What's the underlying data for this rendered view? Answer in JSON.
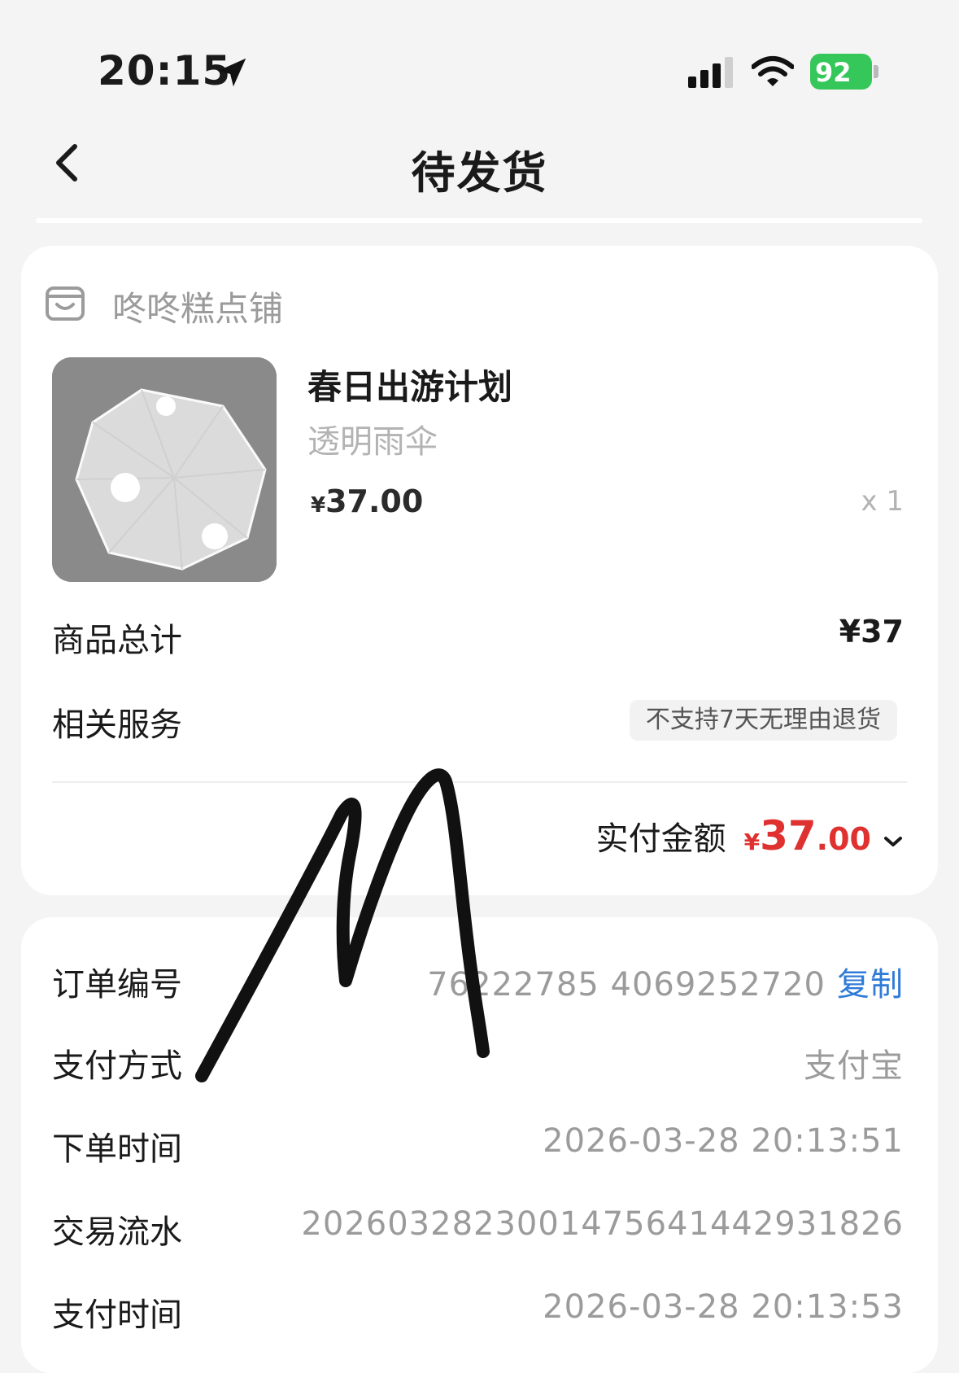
{
  "status_bar": {
    "time": "20:15",
    "battery": "92",
    "battery_color": "#35c759",
    "icons": [
      "location-arrow-icon",
      "cellular-signal-icon",
      "wifi-icon",
      "battery-icon"
    ]
  },
  "nav": {
    "title": "待发货",
    "back_icon": "chevron-left-icon"
  },
  "order_card": {
    "shop_icon": "store-icon",
    "shop_name": "咚咚糕点铺",
    "product": {
      "name": "春日出游计划",
      "subtitle": "透明雨伞",
      "price_symbol": "¥",
      "price": "37.00",
      "quantity": "x 1"
    },
    "goods_total_label": "商品总计",
    "goods_total_value": "¥37",
    "service_label": "相关服务",
    "service_tag": "不支持7天无理由退货",
    "paid_label": "实付金额",
    "paid_symbol": "¥",
    "paid_int": "37",
    "paid_dec": ".00",
    "accent_color": "#e03131"
  },
  "details_card": {
    "order_no_label": "订单编号",
    "order_no_value": "76222785  4069252720",
    "copy_label": "复制",
    "payment_label": "支付方式",
    "payment_value": "支付宝",
    "order_time_label": "下单时间",
    "order_time_value": "2026-03-28 20:13:51",
    "transaction_label": "交易流水",
    "transaction_value": "2026032823001475641442931826",
    "pay_time_label": "支付时间",
    "pay_time_value": "2026-03-28 20:13:53",
    "link_color": "#2f7bd8"
  }
}
